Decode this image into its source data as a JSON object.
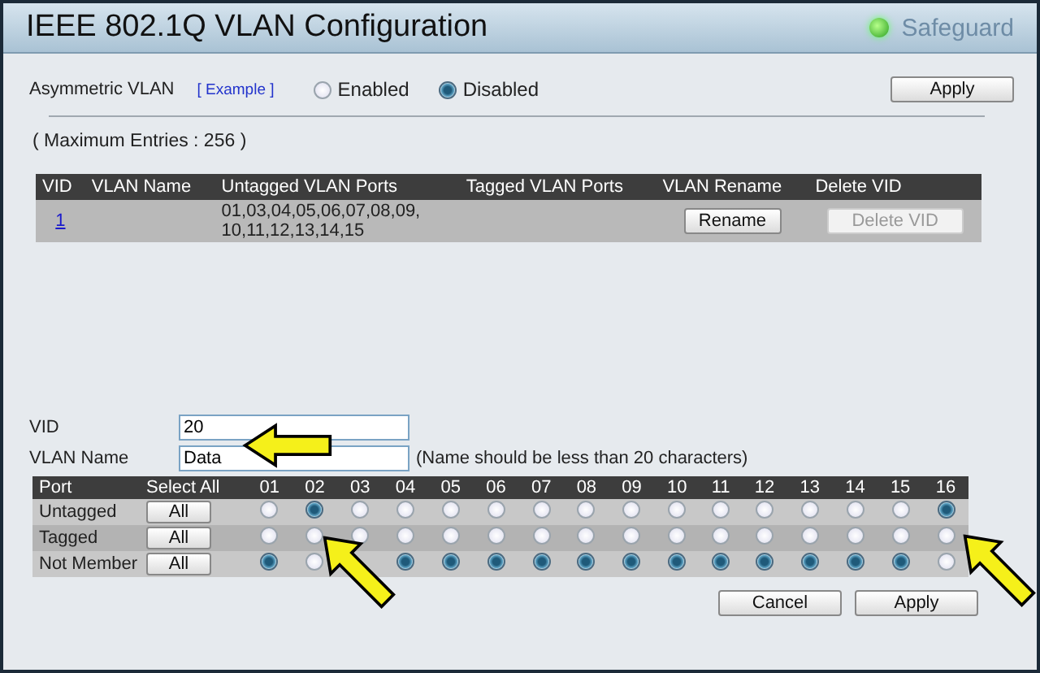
{
  "window": {
    "title": "IEEE 802.1Q VLAN Configuration",
    "status": "Safeguard"
  },
  "asymmetric": {
    "label": "Asymmetric VLAN",
    "link": "[ Example ]",
    "options": [
      {
        "label": "Enabled",
        "selected": false
      },
      {
        "label": "Disabled",
        "selected": true
      }
    ],
    "button": "Apply"
  },
  "max_entries": "( Maximum Entries : 256 )",
  "vlan_table": {
    "columns": [
      "VID",
      "VLAN Name",
      "Untagged VLAN Ports",
      "Tagged VLAN Ports",
      "VLAN Rename",
      "Delete VID"
    ],
    "rows": [
      {
        "vid": "1",
        "name": "",
        "untagged_line_1": "01,03,04,05,06,07,08,09,",
        "untagged_line_2": "10,11,12,13,14,15",
        "tagged": "",
        "rename": "Rename",
        "delete": "Delete VID",
        "delete_disabled": true
      }
    ]
  },
  "form": {
    "vid_label": "VID",
    "vid": "20",
    "name_label": "VLAN Name",
    "name": "Data",
    "hint": "(Name should be less than 20 characters)"
  },
  "port_table": {
    "port_header": "Port",
    "select_all_header": "Select All",
    "ports": [
      "01",
      "02",
      "03",
      "04",
      "05",
      "06",
      "07",
      "08",
      "09",
      "10",
      "11",
      "12",
      "13",
      "14",
      "15",
      "16"
    ],
    "rows": [
      {
        "label": "Untagged",
        "button": "All",
        "cells": [
          {
            "selected": false
          },
          {
            "selected": true
          },
          {
            "selected": false
          },
          {
            "selected": false
          },
          {
            "selected": false
          },
          {
            "selected": false
          },
          {
            "selected": false
          },
          {
            "selected": false
          },
          {
            "selected": false
          },
          {
            "selected": false
          },
          {
            "selected": false
          },
          {
            "selected": false
          },
          {
            "selected": false
          },
          {
            "selected": false
          },
          {
            "selected": false
          },
          {
            "selected": true
          }
        ]
      },
      {
        "label": "Tagged",
        "button": "All",
        "cells": [
          {
            "selected": false
          },
          {
            "selected": false
          },
          {
            "selected": false
          },
          {
            "selected": false
          },
          {
            "selected": false
          },
          {
            "selected": false
          },
          {
            "selected": false
          },
          {
            "selected": false
          },
          {
            "selected": false
          },
          {
            "selected": false
          },
          {
            "selected": false
          },
          {
            "selected": false
          },
          {
            "selected": false
          },
          {
            "selected": false
          },
          {
            "selected": false
          },
          {
            "selected": false
          }
        ]
      },
      {
        "label": "Not Member",
        "button": "All",
        "cells": [
          {
            "selected": true
          },
          {
            "selected": false
          },
          null,
          {
            "selected": true
          },
          {
            "selected": true
          },
          {
            "selected": true
          },
          {
            "selected": true
          },
          {
            "selected": true
          },
          {
            "selected": true
          },
          {
            "selected": true
          },
          {
            "selected": true
          },
          {
            "selected": true
          },
          {
            "selected": true
          },
          {
            "selected": true
          },
          {
            "selected": true
          },
          {
            "selected": false
          }
        ]
      }
    ]
  },
  "buttons": [
    "Cancel",
    "Apply"
  ]
}
